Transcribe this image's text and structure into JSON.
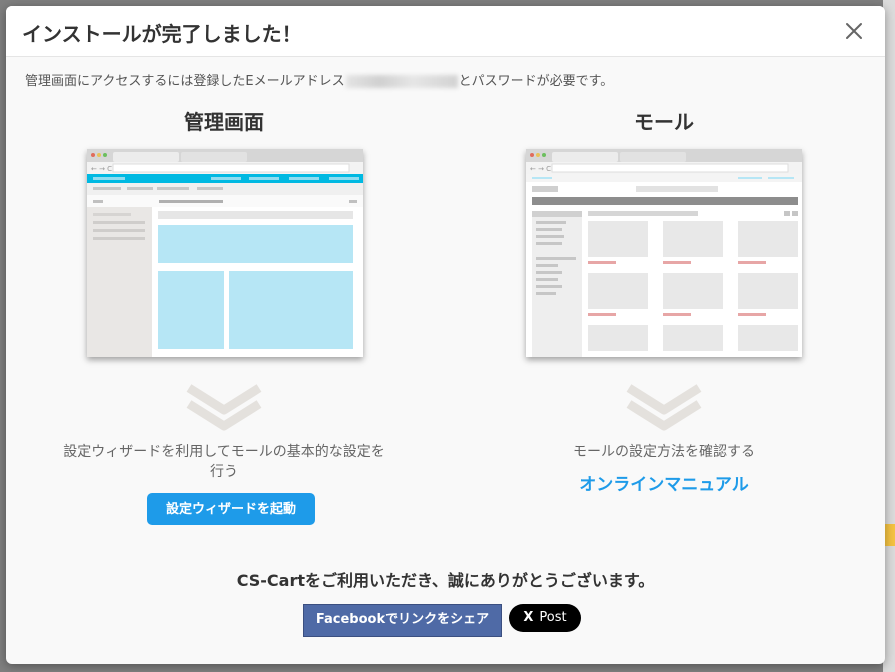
{
  "modal": {
    "title": "インストールが完了しました！",
    "close_icon": "close-icon",
    "intro_before": "管理画面にアクセスするには登録したEメールアドレス",
    "intro_after": "とパスワードが必要です。"
  },
  "admin": {
    "title": "管理画面",
    "description": "設定ウィザードを利用してモールの基本的な設定を行う",
    "button_label": "設定ウィザードを起動"
  },
  "store": {
    "title": "モール",
    "description": "モールの設定方法を確認する",
    "link_label": "オンラインマニュアル"
  },
  "footer": {
    "thanks": "CS-Cartをご利用いただき、誠にありがとうございます。",
    "facebook_label": "Facebookでリンクをシェア",
    "x_logo": "X",
    "x_label": "Post"
  },
  "colors": {
    "accent": "#1e9be9",
    "admin_header": "#00b9e2",
    "admin_panel": "#b6e6f5",
    "store_price": "#e7a6a6",
    "facebook": "#4f6aa6"
  }
}
